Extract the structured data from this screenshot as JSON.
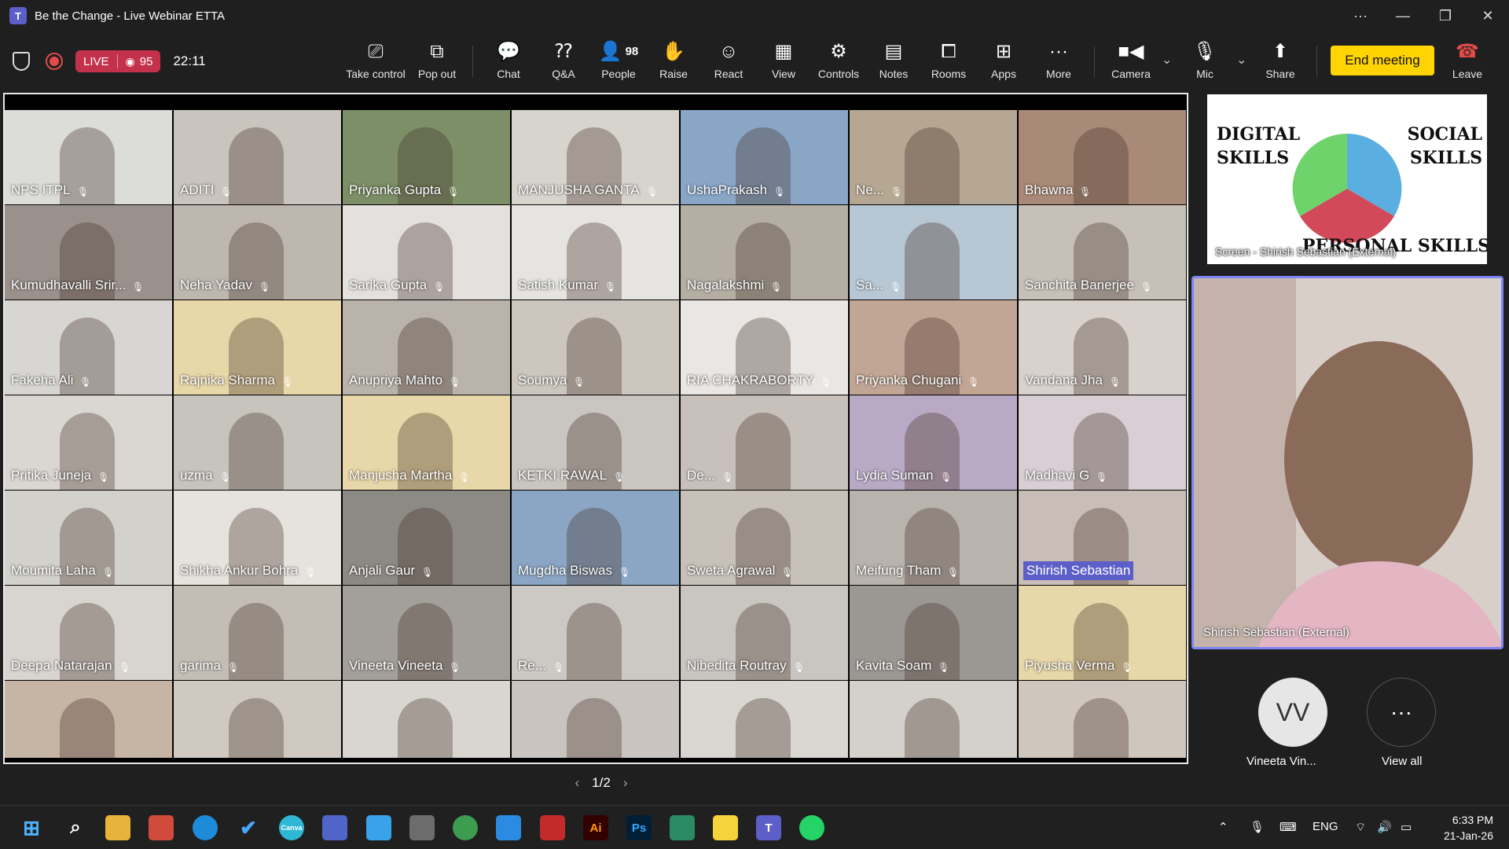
{
  "window": {
    "title": "Be the Change - Live Webinar ETTA",
    "more": "···",
    "minimize": "—",
    "maximize": "❐",
    "close": "✕"
  },
  "toolbar": {
    "live_label": "LIVE",
    "viewer_count": "95",
    "timer": "22:11",
    "take_control": "Take control",
    "pop_out": "Pop out",
    "chat": "Chat",
    "qa": "Q&A",
    "people": "People",
    "people_count": "98",
    "raise": "Raise",
    "react": "React",
    "view": "View",
    "controls": "Controls",
    "notes": "Notes",
    "rooms": "Rooms",
    "apps": "Apps",
    "more": "More",
    "camera": "Camera",
    "mic": "Mic",
    "share": "Share",
    "end_meeting": "End meeting",
    "leave": "Leave"
  },
  "participants": [
    {
      "name": "NPS ITPL",
      "bg": "#dcdcd8"
    },
    {
      "name": "ADITI",
      "bg": "#c9c4bd"
    },
    {
      "name": "Priyanka Gupta",
      "bg": "#7c8f67"
    },
    {
      "name": "MANJUSHA GANTA",
      "bg": "#d7d3cd"
    },
    {
      "name": "UshaPrakash",
      "bg": "#8aa6c7"
    },
    {
      "name": "Ne...",
      "bg": "#b6a793"
    },
    {
      "name": "Bhawna",
      "bg": "#a98a78"
    },
    {
      "name": "Kumudhavalli Srir...",
      "bg": "#9a918c"
    },
    {
      "name": "Neha Yadav",
      "bg": "#bdb7af"
    },
    {
      "name": "Sarika Gupta",
      "bg": "#e3e0dd"
    },
    {
      "name": "Satish Kumar",
      "bg": "#e6e4e1"
    },
    {
      "name": "Nagalakshmi",
      "bg": "#b4aea3"
    },
    {
      "name": "Sa...",
      "bg": "#b7c8d4"
    },
    {
      "name": "Sanchita Banerjee",
      "bg": "#c6c0b8"
    },
    {
      "name": "Fakeha Ali",
      "bg": "#d8d6d3"
    },
    {
      "name": "Rajnika Sharma",
      "bg": "#e8d7a8"
    },
    {
      "name": "Anupriya Mahto",
      "bg": "#b9b3ab"
    },
    {
      "name": "Soumya",
      "bg": "#ccc6be"
    },
    {
      "name": "RIA CHAKRABORTY",
      "bg": "#e9e6e3"
    },
    {
      "name": "Priyanka Chugani",
      "bg": "#c1a595"
    },
    {
      "name": "Vandana Jha",
      "bg": "#d9d2cc"
    },
    {
      "name": "Pritika Juneja",
      "bg": "#dad7d2"
    },
    {
      "name": "uzma",
      "bg": "#c7c3bd"
    },
    {
      "name": "Manjusha Martha",
      "bg": "#e8d7a8"
    },
    {
      "name": "KETKI RAWAL",
      "bg": "#c9c5c0"
    },
    {
      "name": "De...",
      "bg": "#c8c0bb"
    },
    {
      "name": "Lydia Suman",
      "bg": "#b8a9c4"
    },
    {
      "name": "Madhavi G",
      "bg": "#d8ced4"
    },
    {
      "name": "Moumita Laha",
      "bg": "#d3d1cb"
    },
    {
      "name": "Shikha Ankur Bohra",
      "bg": "#e6e3de"
    },
    {
      "name": "Anjali Gaur",
      "bg": "#8d8985"
    },
    {
      "name": "Mugdha Biswas",
      "bg": "#8aa6c4"
    },
    {
      "name": "Sweta Agrawal",
      "bg": "#c7c1ba"
    },
    {
      "name": "Meifung Tham",
      "bg": "#b9b3ae"
    },
    {
      "name": "Shirish Sebastian",
      "bg": "#c9beb7"
    },
    {
      "name": "Deepa Natarajan",
      "bg": "#d8d4cf"
    },
    {
      "name": "garima",
      "bg": "#c3bdb6"
    },
    {
      "name": "Vineeta Vineeta",
      "bg": "#a39f9a"
    },
    {
      "name": "Re...",
      "bg": "#ccc8c3"
    },
    {
      "name": "Nibedita Routray",
      "bg": "#c9c5c1"
    },
    {
      "name": "Kavita Soam",
      "bg": "#9b9894"
    },
    {
      "name": "Piyusha Verma",
      "bg": "#e8d7a8"
    },
    {
      "name": "",
      "bg": "#c6b4a5"
    },
    {
      "name": "",
      "bg": "#cfc9c2"
    },
    {
      "name": "",
      "bg": "#d9d6d2"
    },
    {
      "name": "",
      "bg": "#c9c4bf"
    },
    {
      "name": "",
      "bg": "#dad6d2"
    },
    {
      "name": "",
      "bg": "#d4d0cb"
    },
    {
      "name": "",
      "bg": "#cfc6bd"
    }
  ],
  "pager": {
    "label": "1/2",
    "prev": "‹",
    "next": "›"
  },
  "screen_share": {
    "label": "Screen - Shirish Sebastian (External)",
    "text_left": "DIGITAL SKILLS",
    "text_right": "SOCIAL SKILLS",
    "text_bottom": "PERSONAL SKILLS"
  },
  "speaker": {
    "name": "Shirish Sebastian (External)"
  },
  "side_participants": {
    "avatar_initials": "VV",
    "avatar_name": "Vineeta Vin...",
    "view_all_label": "View all",
    "view_all_icon": "···"
  },
  "taskbar": {
    "lang": "ENG",
    "time": "6:33 PM",
    "date": "21-Jan-26"
  },
  "colors": {
    "accent": "#5b5fc7",
    "live": "#c4314b",
    "end_meeting": "#ffd400",
    "leave": "#e34b4b"
  }
}
